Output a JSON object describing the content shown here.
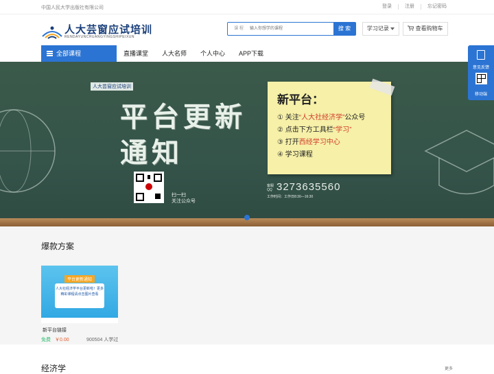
{
  "topbar": {
    "publisher": "中国人民大学出版社有限公司",
    "links": [
      "登录",
      "注册",
      "忘记密码"
    ]
  },
  "header": {
    "logo_title": "人大芸窗应试培训",
    "logo_pinyin": "RENDAYUNCHUANGYINGSHIPEIXUN",
    "search": {
      "category": "课 程",
      "placeholder": "输入你想学的课程",
      "button": "搜 索"
    },
    "study_record": "学习记录",
    "cart": "查看购物车"
  },
  "nav": {
    "all_courses": "全部课程",
    "items": [
      "直播课堂",
      "人大名师",
      "个人中心",
      "APP下载"
    ]
  },
  "banner": {
    "mini_logo": "人大芸窗应试培训",
    "headline_line1": "平台更新",
    "headline_line2": "通知",
    "qr_caption_1": "扫一扫",
    "qr_caption_2": "关注公众号",
    "note_title": "新平台：",
    "note_lines": [
      {
        "pre": "① 关注",
        "hl": "“人大社经济学”",
        "post": "公众号"
      },
      {
        "pre": "② 点击下方工具栏",
        "hl": "“学习”",
        "post": ""
      },
      {
        "pre": "③ 打开",
        "hl": "西经学习中心",
        "post": ""
      },
      {
        "pre": "④ 学习课程",
        "hl": "",
        "post": ""
      }
    ],
    "hotline_label": "客服QQ",
    "hotline": "3273635560",
    "work_time": "工作时间：工作日8:30—16:30"
  },
  "section_hot": {
    "title": "爆款方案",
    "card": {
      "thumb_header": "平台更新通知",
      "thumb_text": "人大社经济学平台更新啦！更多精彩课程请点击图片查看",
      "name": "新平台链接",
      "free": "免费",
      "price": "￥0.00",
      "learners": "900504 人学过"
    }
  },
  "section_econ": {
    "title": "经济学",
    "more": "更多"
  },
  "side_float": {
    "feedback": "意见反馈",
    "mobile": "移动端"
  },
  "colors": {
    "brand_blue": "#2b74d3",
    "chalkboard": "#3b5a4a",
    "note_yellow": "#f6f0a8",
    "highlight_red": "#d23b2b",
    "free_green": "#2fbb6f",
    "price_orange": "#e25a2a"
  }
}
